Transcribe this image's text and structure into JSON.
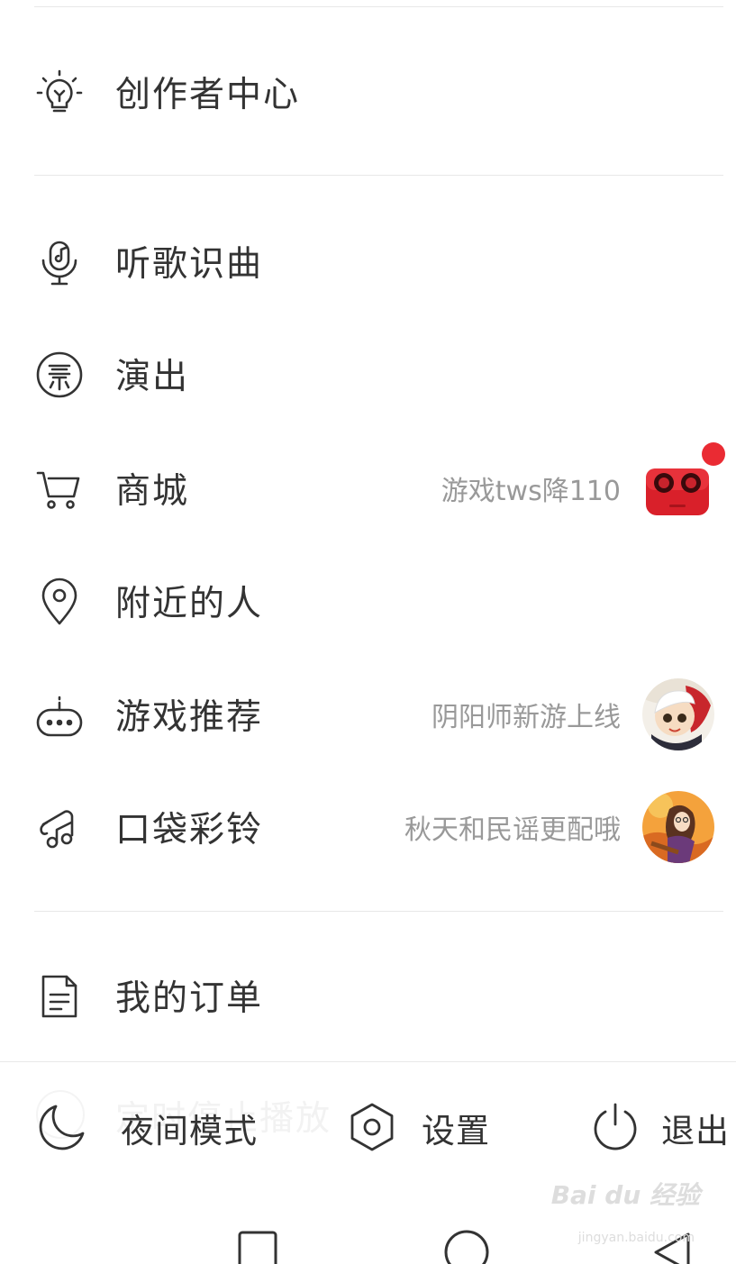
{
  "menu": {
    "creator": {
      "label": "创作者中心",
      "icon": "lightbulb-icon"
    },
    "items": [
      {
        "label": "听歌识曲",
        "icon": "mic-icon",
        "hint": ""
      },
      {
        "label": "演出",
        "icon": "ticket-icon",
        "hint": ""
      },
      {
        "label": "商城",
        "icon": "cart-icon",
        "hint": "游戏tws降110",
        "thumb": "earbuds-thumb"
      },
      {
        "label": "附近的人",
        "icon": "location-pin-icon",
        "hint": ""
      },
      {
        "label": "游戏推荐",
        "icon": "gamepad-icon",
        "hint": "阴阳师新游上线",
        "thumb": "game-character-thumb"
      },
      {
        "label": "口袋彩铃",
        "icon": "music-note-icon",
        "hint": "秋天和民谣更配哦",
        "thumb": "folk-girl-thumb"
      }
    ],
    "orders": {
      "label": "我的订单",
      "icon": "document-icon"
    }
  },
  "bottom_bar": {
    "ghost_label": "定时停止播放",
    "night_mode": "夜间模式",
    "settings": "设置",
    "logout": "退出"
  },
  "watermark": {
    "text": "Bai du 经验",
    "sub": "jingyan.baidu.com"
  },
  "colors": {
    "text": "#333333",
    "hint": "#999999",
    "accent": "#ea2b33",
    "divider": "#e8e8e8"
  }
}
